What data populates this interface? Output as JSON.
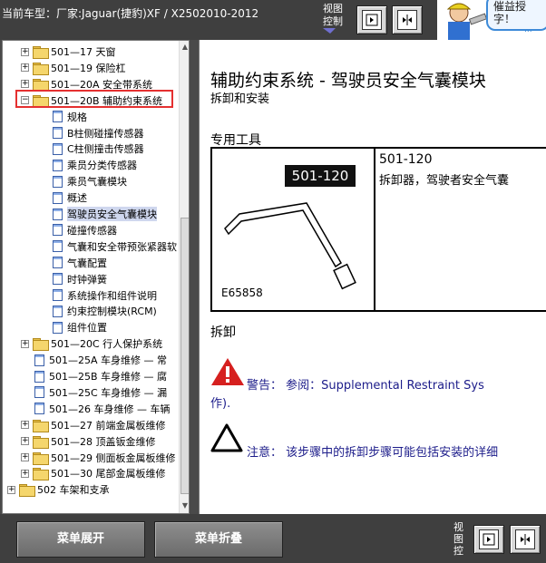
{
  "header": {
    "vehicle_label": "当前车型：厂家:Jaguar(捷豹)XF / X2502010-2012",
    "view_control": "视图控制",
    "ad_text": "催益授字！",
    "ad_more": "..."
  },
  "tree": {
    "items": [
      {
        "label": "501—17 天窗",
        "type": "folder",
        "expander": "+"
      },
      {
        "label": "501—19 保险杠",
        "type": "folder",
        "expander": "+"
      },
      {
        "label": "501—20A 安全带系统",
        "type": "folder",
        "expander": "+"
      },
      {
        "label": "501—20B 辅助约束系统",
        "type": "folder",
        "expander": "−"
      },
      {
        "label": "规格",
        "type": "doc"
      },
      {
        "label": "B柱侧碰撞传感器",
        "type": "doc"
      },
      {
        "label": "C柱侧撞击传感器",
        "type": "doc"
      },
      {
        "label": "乘员分类传感器",
        "type": "doc"
      },
      {
        "label": "乘员气囊模块",
        "type": "doc"
      },
      {
        "label": "概述",
        "type": "doc"
      },
      {
        "label": "驾驶员安全气囊模块",
        "type": "doc",
        "selected": true
      },
      {
        "label": "碰撞传感器",
        "type": "doc"
      },
      {
        "label": "气囊和安全带预张紧器软",
        "type": "doc"
      },
      {
        "label": "气囊配置",
        "type": "doc"
      },
      {
        "label": "时钟弹簧",
        "type": "doc"
      },
      {
        "label": "系统操作和组件说明",
        "type": "doc"
      },
      {
        "label": "约束控制模块(RCM)",
        "type": "doc"
      },
      {
        "label": "组件位置",
        "type": "doc"
      },
      {
        "label": "501—20C 行人保护系统",
        "type": "folder",
        "expander": "+"
      },
      {
        "label": "501—25A 车身维修 — 常",
        "type": "doc2"
      },
      {
        "label": "501—25B 车身维修 — 腐",
        "type": "doc2"
      },
      {
        "label": "501—25C 车身维修 — 漏",
        "type": "doc2"
      },
      {
        "label": "501—26 车身维修 — 车辆",
        "type": "doc2"
      },
      {
        "label": "501—27 前端金属板维修",
        "type": "folder",
        "expander": "+"
      },
      {
        "label": "501—28 顶盖钣金维修",
        "type": "folder",
        "expander": "+"
      },
      {
        "label": "501—29 侧面板金属板维修",
        "type": "folder",
        "expander": "+"
      },
      {
        "label": "501—30 尾部金属板维修",
        "type": "folder",
        "expander": "+"
      },
      {
        "label": "502 车架和支承",
        "type": "folder_root",
        "expander": "+"
      }
    ]
  },
  "document": {
    "title": "辅助约束系统 - 驾驶员安全气囊模块",
    "subtitle": "拆卸和安装",
    "tools_heading": "专用工具",
    "tool_number_badge": "501-120",
    "tool_code": "E65858",
    "tool_info_number": "501-120",
    "tool_info_desc": "拆卸器，驾驶者安全气囊",
    "removal_heading": "拆卸",
    "warning_text": "警告：  参阅：Supplemental Restraint Sys",
    "warning_cont": "作).",
    "caution_text": "注意：  该步骤中的拆卸步骤可能包括安装的详细"
  },
  "footer": {
    "expand_menu": "菜单展开",
    "collapse_menu": "菜单折叠",
    "view_control": "视图控"
  },
  "colors": {
    "bar_bg": "#3f3f3f",
    "highlight": "#e53030",
    "warning_red": "#d6201f",
    "link_blue": "#1c1c8a"
  }
}
